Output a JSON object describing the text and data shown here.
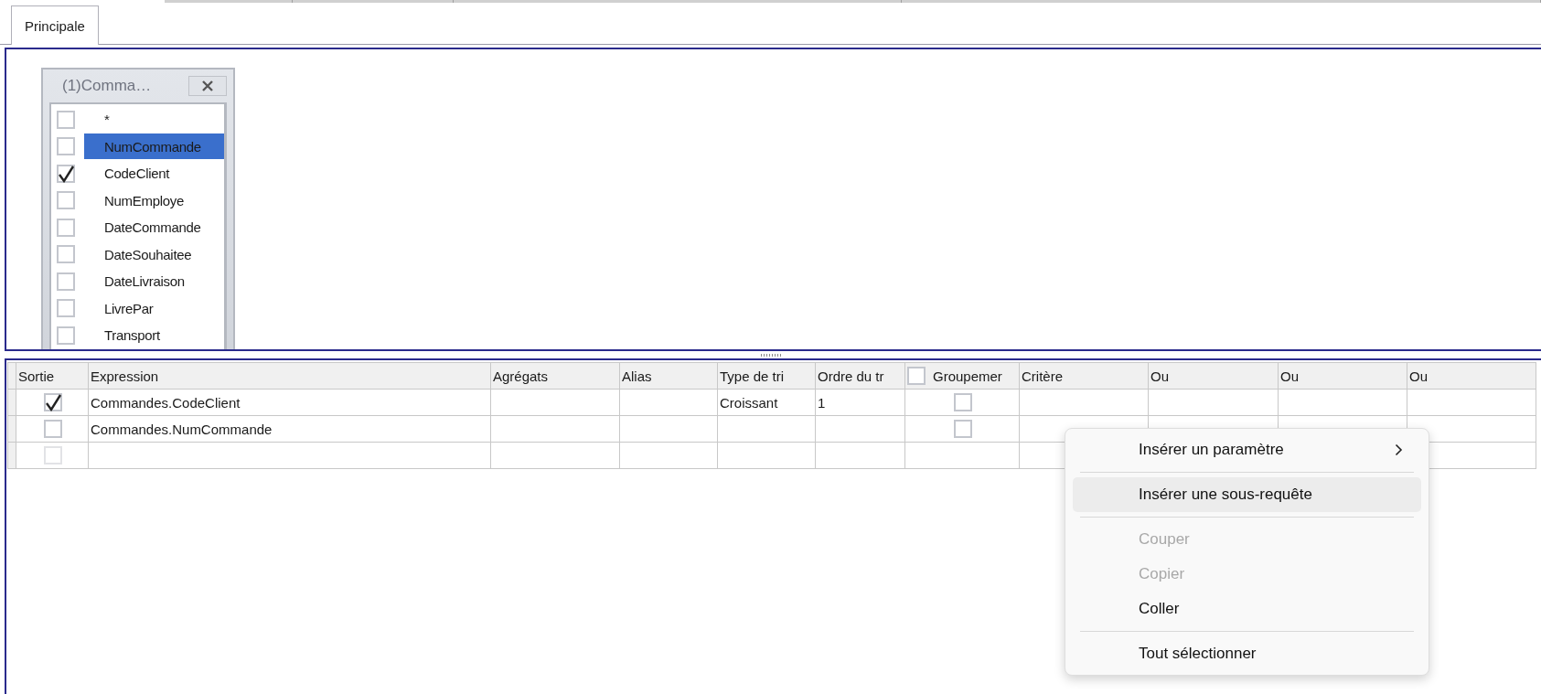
{
  "tabs": [
    {
      "label": "Principale",
      "selected": true
    }
  ],
  "table_window": {
    "title": "(1)Comma…",
    "fields": [
      {
        "name": "*",
        "checked": false,
        "selected": false
      },
      {
        "name": "NumCommande",
        "checked": false,
        "selected": true
      },
      {
        "name": "CodeClient",
        "checked": true,
        "selected": false
      },
      {
        "name": "NumEmploye",
        "checked": false,
        "selected": false
      },
      {
        "name": "DateCommande",
        "checked": false,
        "selected": false
      },
      {
        "name": "DateSouhaitee",
        "checked": false,
        "selected": false
      },
      {
        "name": "DateLivraison",
        "checked": false,
        "selected": false
      },
      {
        "name": "LivrePar",
        "checked": false,
        "selected": false
      },
      {
        "name": "Transport",
        "checked": false,
        "selected": false
      }
    ]
  },
  "grid": {
    "columns": [
      {
        "kind": "text",
        "label": "Sortie"
      },
      {
        "kind": "text",
        "label": "Expression"
      },
      {
        "kind": "text",
        "label": "Agrégats"
      },
      {
        "kind": "text",
        "label": "Alias"
      },
      {
        "kind": "text",
        "label": "Type de tri"
      },
      {
        "kind": "text",
        "label": "Ordre du tr"
      },
      {
        "kind": "checkbox",
        "label": "Groupemer",
        "checked": false
      },
      {
        "kind": "text",
        "label": "Critère"
      },
      {
        "kind": "text",
        "label": "Ou"
      },
      {
        "kind": "text",
        "label": "Ou"
      },
      {
        "kind": "text",
        "label": "Ou"
      }
    ],
    "rows": [
      {
        "output": {
          "checked": true,
          "disabled": false
        },
        "expression": "Commandes.CodeClient",
        "sort_type": "Croissant",
        "sort_order": "1",
        "group_by": {
          "checked": false
        }
      },
      {
        "output": {
          "checked": false,
          "disabled": false
        },
        "expression": "Commandes.NumCommande",
        "group_by": {
          "checked": false
        }
      },
      {
        "output": {
          "checked": false,
          "disabled": true
        }
      }
    ]
  },
  "context_menu": [
    {
      "kind": "item",
      "label": "Insérer un paramètre",
      "submenu": true,
      "disabled": false,
      "highlighted": false
    },
    {
      "kind": "separator"
    },
    {
      "kind": "item",
      "label": "Insérer une sous-requête",
      "submenu": false,
      "disabled": false,
      "highlighted": true
    },
    {
      "kind": "separator"
    },
    {
      "kind": "item",
      "label": "Couper",
      "submenu": false,
      "disabled": true,
      "highlighted": false
    },
    {
      "kind": "item",
      "label": "Copier",
      "submenu": false,
      "disabled": true,
      "highlighted": false
    },
    {
      "kind": "item",
      "label": "Coller",
      "submenu": false,
      "disabled": false,
      "highlighted": false
    },
    {
      "kind": "separator"
    },
    {
      "kind": "item",
      "label": "Tout sélectionner",
      "submenu": false,
      "disabled": false,
      "highlighted": false
    }
  ]
}
